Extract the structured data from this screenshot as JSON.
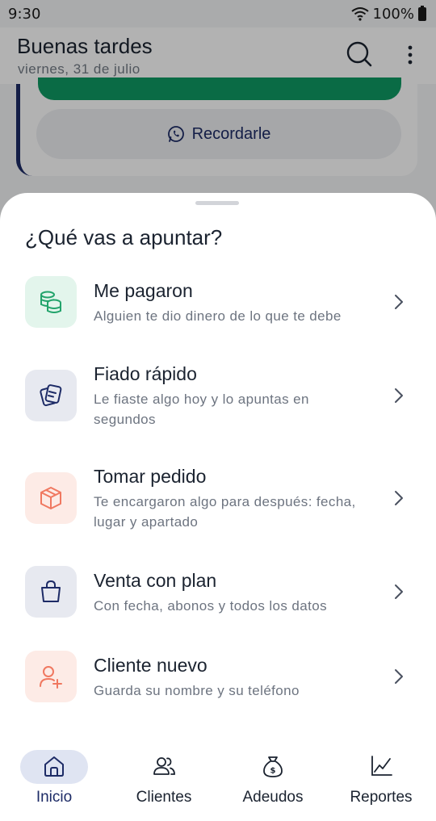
{
  "status_bar": {
    "time": "9:30",
    "battery": "100%"
  },
  "header": {
    "greeting": "Buenas tardes",
    "date": "viernes, 31 de julio"
  },
  "card": {
    "remind_label": "Recordarle"
  },
  "sheet": {
    "title": "¿Qué vas a apuntar?",
    "options": [
      {
        "title": "Me pagaron",
        "desc": "Alguien te dio dinero de lo que te debe",
        "icon": "coins-stack-icon",
        "color": "#22a36b",
        "bg": "#e3f5ec"
      },
      {
        "title": "Fiado rápido",
        "desc": "Le fiaste algo hoy y lo apuntas en segundos",
        "icon": "note-cards-icon",
        "color": "#1d2b66",
        "bg": "#e7e9f0"
      },
      {
        "title": "Tomar pedido",
        "desc": "Te encargaron algo para después: fecha, lugar y apartado",
        "icon": "package-box-icon",
        "color": "#f07860",
        "bg": "#fdebe6"
      },
      {
        "title": "Venta con plan",
        "desc": "Con fecha, abonos y todos los datos",
        "icon": "shopping-bag-icon",
        "color": "#1d2b66",
        "bg": "#e7e9f0"
      },
      {
        "title": "Cliente nuevo",
        "desc": "Guarda su nombre y su teléfono",
        "icon": "user-plus-icon",
        "color": "#f07860",
        "bg": "#fdebe6"
      }
    ]
  },
  "nav": {
    "items": [
      {
        "label": "Inicio",
        "icon": "home-icon",
        "active": true
      },
      {
        "label": "Clientes",
        "icon": "users-icon",
        "active": false
      },
      {
        "label": "Adeudos",
        "icon": "money-bag-icon",
        "active": false
      },
      {
        "label": "Reportes",
        "icon": "chart-line-icon",
        "active": false
      }
    ]
  },
  "colors": {
    "primary": "#1d2b66",
    "green": "#0f9a63",
    "scrim": "rgba(0,0,0,0.30)"
  }
}
